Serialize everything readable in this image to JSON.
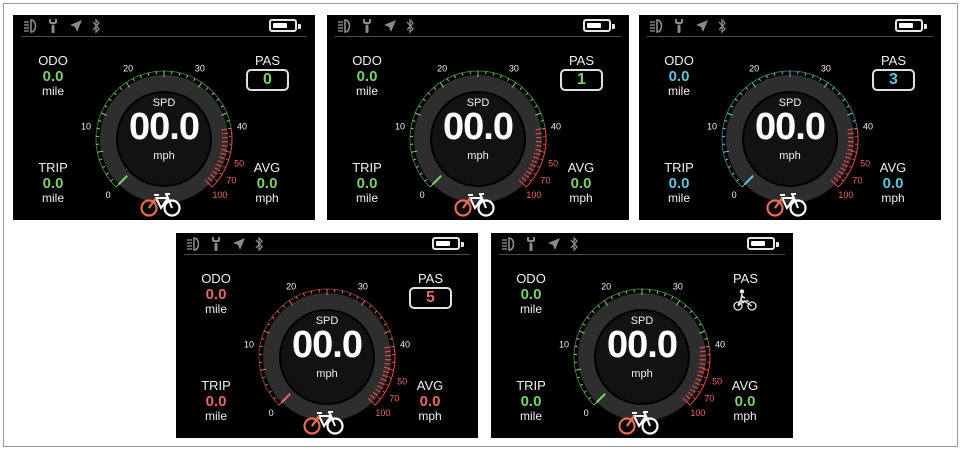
{
  "screens": [
    {
      "accent": "#7ccf6a",
      "icons": [
        "headlight-icon",
        "wrench-icon",
        "navigation-icon",
        "bluetooth-icon"
      ],
      "odo": {
        "label": "ODO",
        "value": "0.0",
        "unit": "mile"
      },
      "trip": {
        "label": "TRIP",
        "value": "0.0",
        "unit": "mile"
      },
      "avg": {
        "label": "AVG",
        "value": "0.0",
        "unit": "mph"
      },
      "pas": {
        "label": "PAS",
        "value": "0"
      },
      "speed": {
        "label": "SPD",
        "value": "00.0",
        "unit": "mph"
      },
      "ticks": [
        "0",
        "10",
        "20",
        "30",
        "40",
        "50",
        "70",
        "100"
      ]
    },
    {
      "accent": "#7ccf6a",
      "icons": [
        "headlight-icon",
        "wrench-icon",
        "navigation-icon",
        "bluetooth-icon"
      ],
      "odo": {
        "label": "ODO",
        "value": "0.0",
        "unit": "mile"
      },
      "trip": {
        "label": "TRIP",
        "value": "0.0",
        "unit": "mile"
      },
      "avg": {
        "label": "AVG",
        "value": "0.0",
        "unit": "mph"
      },
      "pas": {
        "label": "PAS",
        "value": "1"
      },
      "speed": {
        "label": "SPD",
        "value": "00.0",
        "unit": "mph"
      },
      "ticks": [
        "0",
        "10",
        "20",
        "30",
        "40",
        "50",
        "70",
        "100"
      ]
    },
    {
      "accent": "#5ec6d6",
      "icons": [
        "headlight-icon",
        "wrench-icon",
        "navigation-icon",
        "bluetooth-icon"
      ],
      "odo": {
        "label": "ODO",
        "value": "0.0",
        "unit": "mile"
      },
      "trip": {
        "label": "TRIP",
        "value": "0.0",
        "unit": "mile"
      },
      "avg": {
        "label": "AVG",
        "value": "0.0",
        "unit": "mph"
      },
      "pas": {
        "label": "PAS",
        "value": "3"
      },
      "speed": {
        "label": "SPD",
        "value": "00.0",
        "unit": "mph"
      },
      "ticks": [
        "0",
        "10",
        "20",
        "30",
        "40",
        "50",
        "70",
        "100"
      ]
    },
    {
      "accent": "#e26a6a",
      "icons": [
        "headlight-icon",
        "wrench-icon",
        "navigation-icon",
        "bluetooth-icon"
      ],
      "odo": {
        "label": "ODO",
        "value": "0.0",
        "unit": "mile"
      },
      "trip": {
        "label": "TRIP",
        "value": "0.0",
        "unit": "mile"
      },
      "avg": {
        "label": "AVG",
        "value": "0.0",
        "unit": "mph"
      },
      "pas": {
        "label": "PAS",
        "value": "5"
      },
      "speed": {
        "label": "SPD",
        "value": "00.0",
        "unit": "mph"
      },
      "ticks": [
        "0",
        "10",
        "20",
        "30",
        "40",
        "50",
        "70",
        "100"
      ]
    },
    {
      "accent": "#7ccf6a",
      "icons": [
        "headlight-icon",
        "wrench-icon",
        "navigation-icon",
        "bluetooth-icon"
      ],
      "odo": {
        "label": "ODO",
        "value": "0.0",
        "unit": "mile"
      },
      "trip": {
        "label": "TRIP",
        "value": "0.0",
        "unit": "mile"
      },
      "avg": {
        "label": "AVG",
        "value": "0.0",
        "unit": "mph"
      },
      "pas": {
        "label": "PAS",
        "value": "",
        "icon": "walk-assist-icon"
      },
      "speed": {
        "label": "SPD",
        "value": "00.0",
        "unit": "mph"
      },
      "ticks": [
        "0",
        "10",
        "20",
        "30",
        "40",
        "50",
        "70",
        "100"
      ]
    }
  ],
  "redzone": "#e04848",
  "bike_front": "#e86a50",
  "bike_rear": "#ffffff"
}
